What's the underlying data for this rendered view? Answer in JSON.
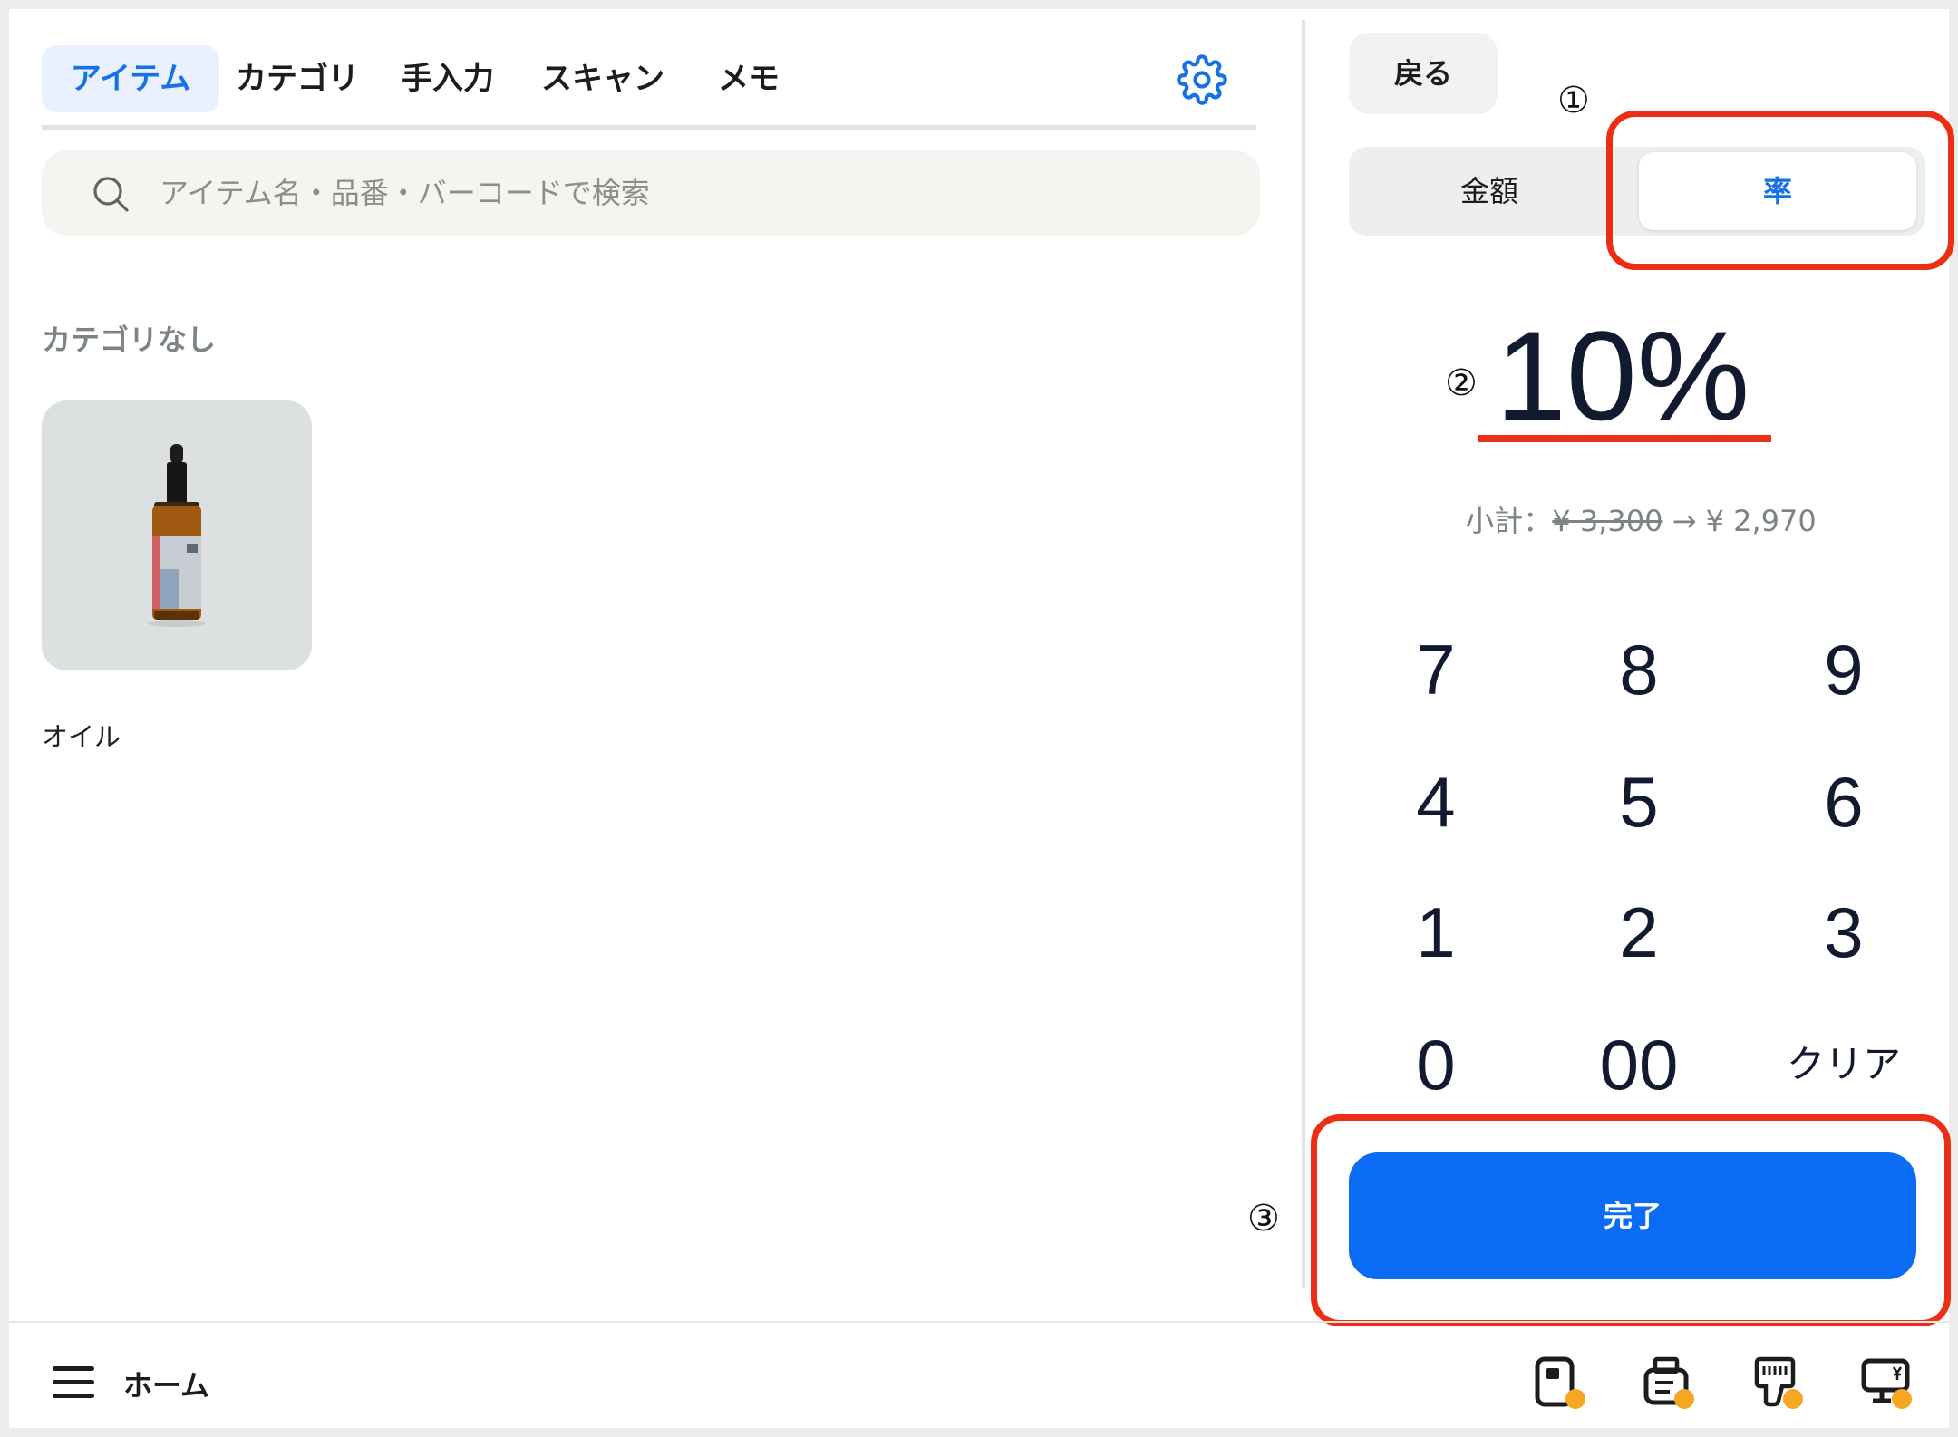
{
  "tabs": [
    {
      "label": "アイテム",
      "active": true
    },
    {
      "label": "カテゴリ",
      "active": false
    },
    {
      "label": "手入力",
      "active": false
    },
    {
      "label": "スキャン",
      "active": false
    },
    {
      "label": "メモ",
      "active": false
    }
  ],
  "search": {
    "placeholder": "アイテム名・品番・バーコードで検索"
  },
  "category": {
    "heading": "カテゴリなし"
  },
  "items": [
    {
      "name": "オイル"
    }
  ],
  "right": {
    "back_label": "戻る",
    "segments": {
      "amount": "金額",
      "rate": "率",
      "selected": "rate"
    },
    "rate_value": "10%",
    "subtotal": {
      "label": "小計：",
      "before": "¥ 3,300",
      "arrow": "→",
      "after": "¥ 2,970"
    },
    "keypad": [
      "7",
      "8",
      "9",
      "4",
      "5",
      "6",
      "1",
      "2",
      "3",
      "0",
      "00",
      "クリア"
    ],
    "done_label": "完了"
  },
  "annotations": {
    "m1": "①",
    "m2": "②",
    "m3": "③"
  },
  "footer": {
    "home_label": "ホーム"
  },
  "colors": {
    "accent": "#1671e8",
    "primary_button": "#0a6cf5",
    "highlight": "#ee2e14",
    "status_dot": "#f5a623"
  }
}
